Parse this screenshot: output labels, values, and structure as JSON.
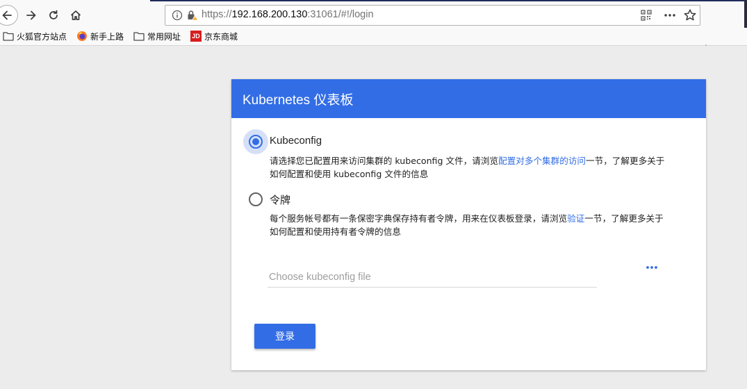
{
  "browser": {
    "url": {
      "scheme": "https://",
      "host": "192.168.200.130",
      "rest": ":31061/#!/login"
    },
    "bookmarks": [
      {
        "label": "火狐官方站点",
        "icon": "folder-icon"
      },
      {
        "label": "新手上路",
        "icon": "firefox-icon"
      },
      {
        "label": "常用网址",
        "icon": "folder-icon"
      },
      {
        "label": "京东商城",
        "icon": "jd-icon",
        "icon_text": "JD"
      }
    ]
  },
  "login": {
    "title": "Kubernetes 仪表板",
    "selected_option": "kubeconfig",
    "kubeconfig": {
      "label": "Kubeconfig",
      "desc_before": "请选择您已配置用来访问集群的 kubeconfig 文件，请浏览",
      "desc_link": "配置对多个集群的访问",
      "desc_after": "一节，了解更多关于如何配置和使用 kubeconfig 文件的信息"
    },
    "token": {
      "label": "令牌",
      "desc_before": "每个服务帐号都有一条保密字典保存持有者令牌，用来在仪表板登录，请浏览",
      "desc_link": "验证",
      "desc_after": "一节，了解更多关于如何配置和使用持有者令牌的信息"
    },
    "file_input_placeholder": "Choose kubeconfig file",
    "login_button": "登录"
  },
  "colors": {
    "primary": "#326de6",
    "background": "#ececec"
  }
}
